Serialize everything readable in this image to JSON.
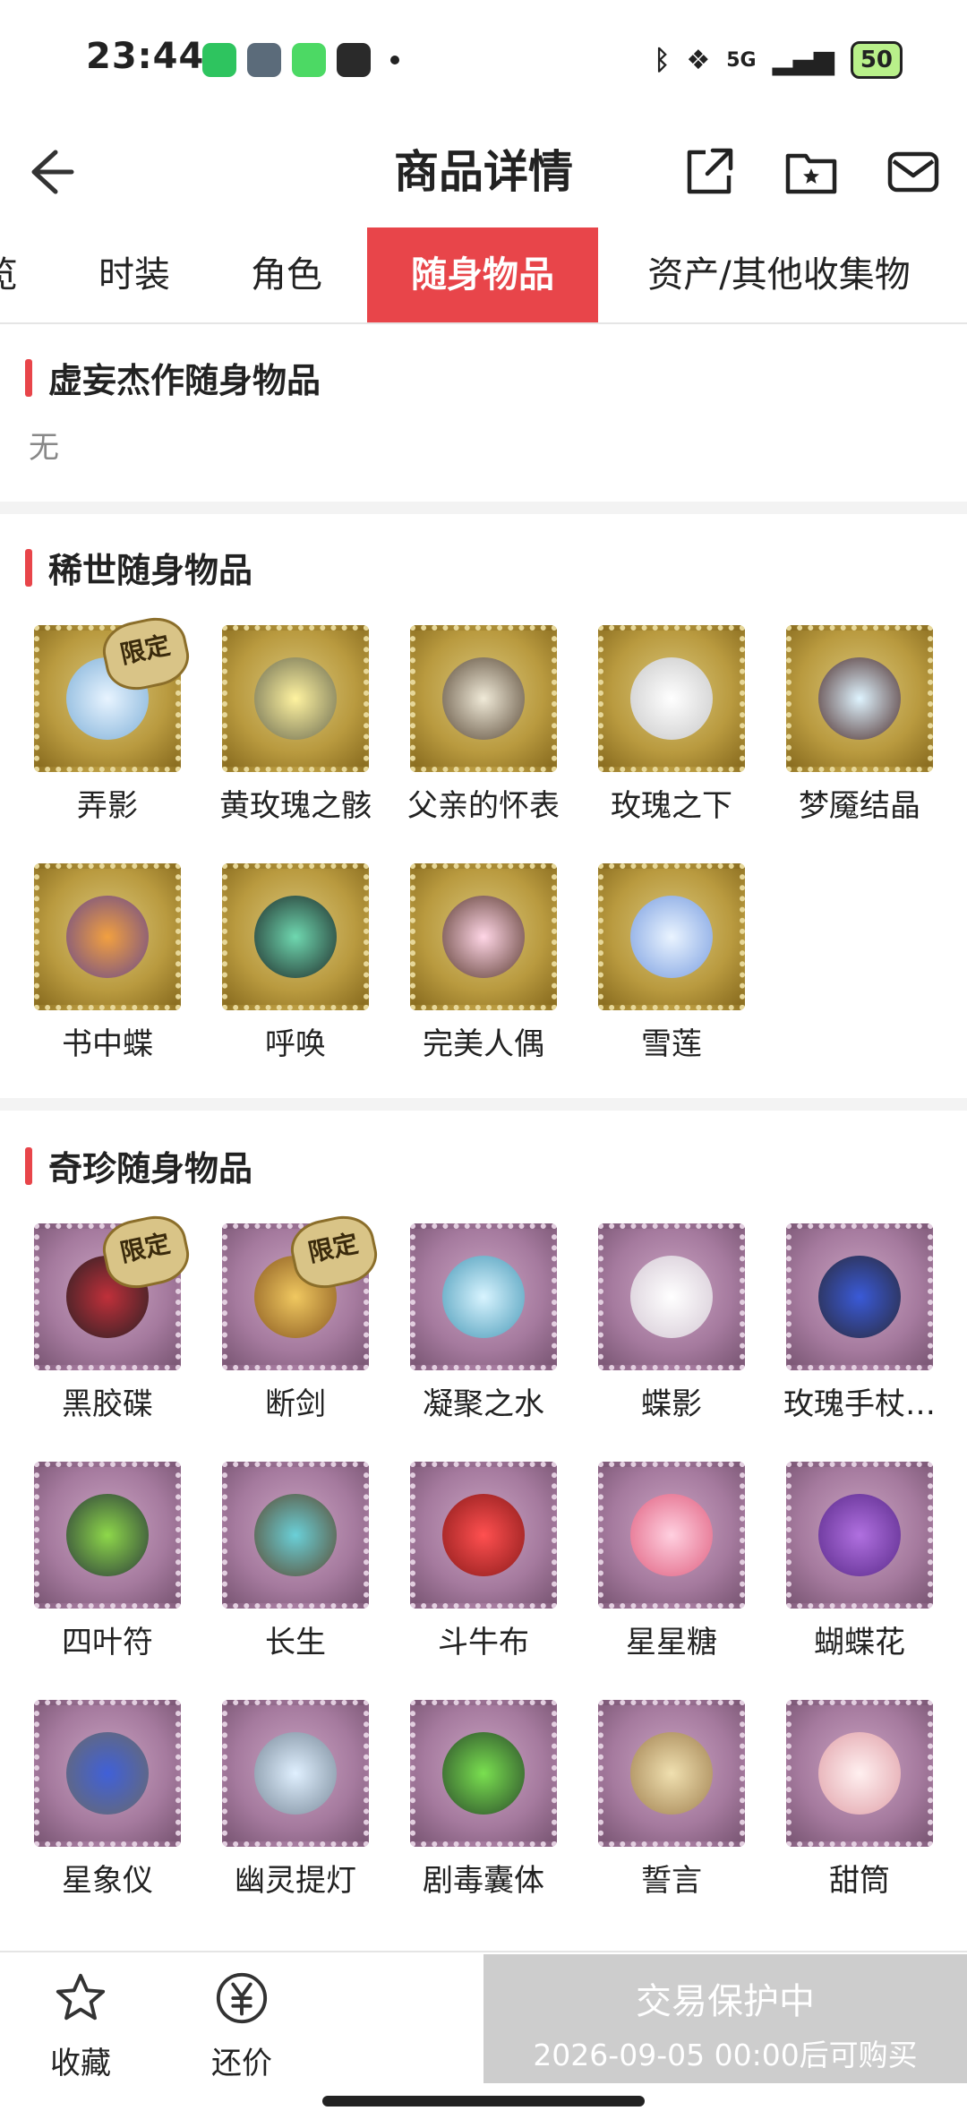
{
  "status_bar": {
    "time": "23:44",
    "network": "5G",
    "battery": "50"
  },
  "header": {
    "title": "商品详情"
  },
  "tabs": [
    {
      "label": "览"
    },
    {
      "label": "时装"
    },
    {
      "label": "角色"
    },
    {
      "label": "随身物品",
      "active": true
    },
    {
      "label": "资产/其他收集物"
    }
  ],
  "sections": {
    "illusory": {
      "title": "虚妄杰作随身物品",
      "empty_text": "无"
    },
    "rare": {
      "title": "稀世随身物品",
      "items": [
        {
          "name": "弄影",
          "badge": "限定"
        },
        {
          "name": "黄玫瑰之骸"
        },
        {
          "name": "父亲的怀表"
        },
        {
          "name": "玫瑰之下"
        },
        {
          "name": "梦魇结晶"
        },
        {
          "name": "书中蝶"
        },
        {
          "name": "呼唤"
        },
        {
          "name": "完美人偶"
        },
        {
          "name": "雪莲"
        }
      ]
    },
    "precious": {
      "title": "奇珍随身物品",
      "items": [
        {
          "name": "黑胶碟",
          "badge": "限定"
        },
        {
          "name": "断剑",
          "badge": "限定"
        },
        {
          "name": "凝聚之水"
        },
        {
          "name": "蝶影"
        },
        {
          "name": "玫瑰手杖…"
        },
        {
          "name": "四叶符"
        },
        {
          "name": "长生"
        },
        {
          "name": "斗牛布"
        },
        {
          "name": "星星糖"
        },
        {
          "name": "蝴蝶花"
        },
        {
          "name": "星象仪"
        },
        {
          "name": "幽灵提灯"
        },
        {
          "name": "剧毒囊体"
        },
        {
          "name": "誓言"
        },
        {
          "name": "甜筒"
        }
      ]
    }
  },
  "bottom": {
    "favorite_label": "收藏",
    "bargain_label": "还价",
    "buy_line1": "交易保护中",
    "buy_line2": "2026-09-05 00:00后可购买"
  },
  "colors": {
    "accent": "#e8454a",
    "disabled": "#cdcdcd"
  }
}
